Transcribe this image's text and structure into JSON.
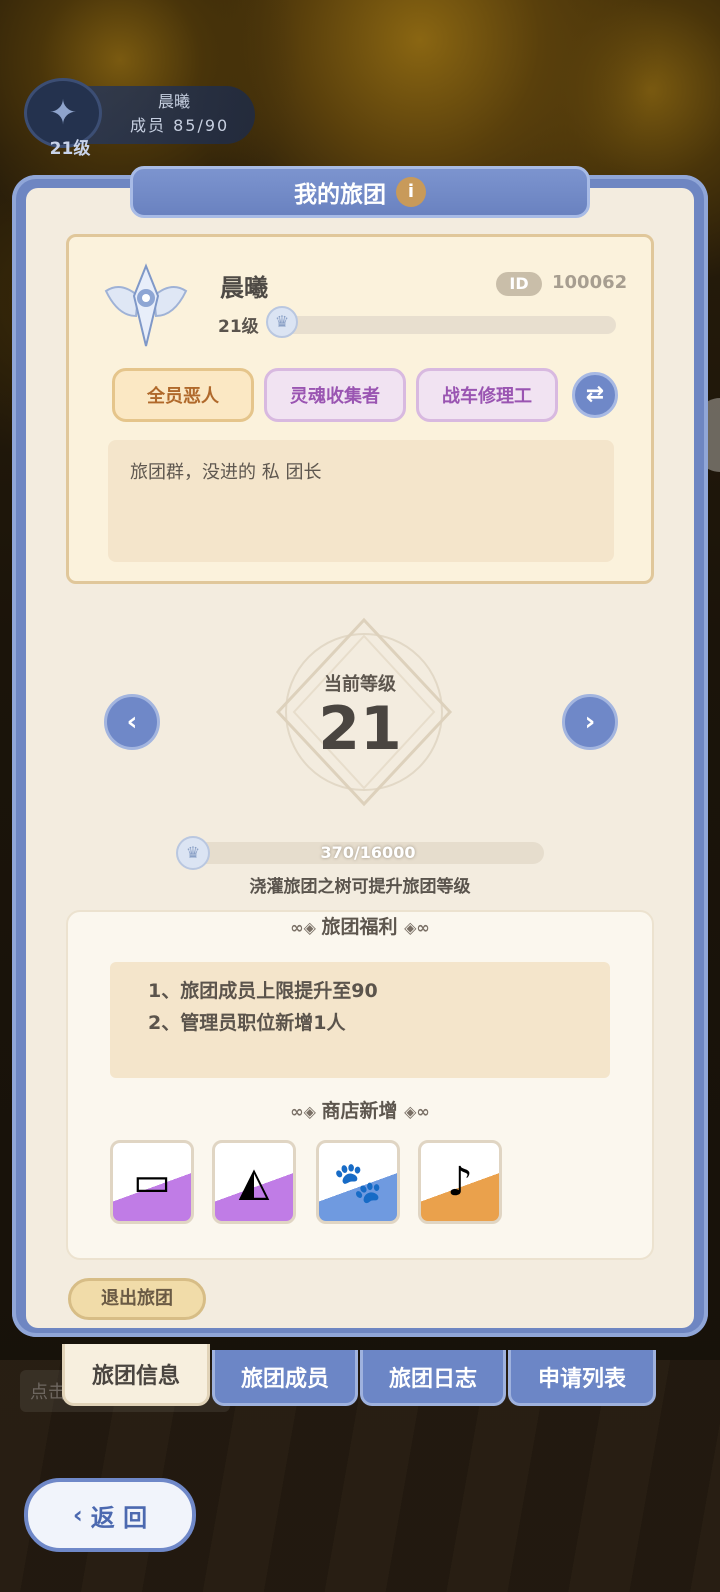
{
  "mini_badge": {
    "name": "晨曦",
    "members": "成员  85/90",
    "level": "21级"
  },
  "panel": {
    "title": "我的旅团"
  },
  "guild": {
    "name": "晨曦",
    "id_label": "ID",
    "id_value": "100062",
    "level_label": "21级",
    "tags": [
      "全员恶人",
      "灵魂收集者",
      "战车修理工"
    ],
    "notice": "旅团群，没进的 私 团长"
  },
  "level_view": {
    "current_label": "当前等级",
    "current_level": "21",
    "progress_text": "370/16000",
    "progress_fraction": 0.023,
    "hint": "浇灌旅团之树可提升旅团等级"
  },
  "benefits": {
    "title": "旅团福利",
    "lines": [
      "1、旅团成员上限提升至90",
      "2、管理员职位新增1人"
    ],
    "shop_title": "商店新增",
    "shop_items": [
      "iron-ingot-icon",
      "cheese-icon",
      "pet-food-bag-icon",
      "lyre-icon"
    ]
  },
  "quit_button": "退出旅团",
  "tabs": [
    "旅团信息",
    "旅团成员",
    "旅团日志",
    "申请列表"
  ],
  "background_tab": "点击",
  "back_button": "返 回",
  "colors": {
    "accent_blue": "#6f88c8",
    "panel_cream": "#f3ecdf",
    "tag_purple": "#9a55b2",
    "tag_gold": "#b0692b"
  }
}
